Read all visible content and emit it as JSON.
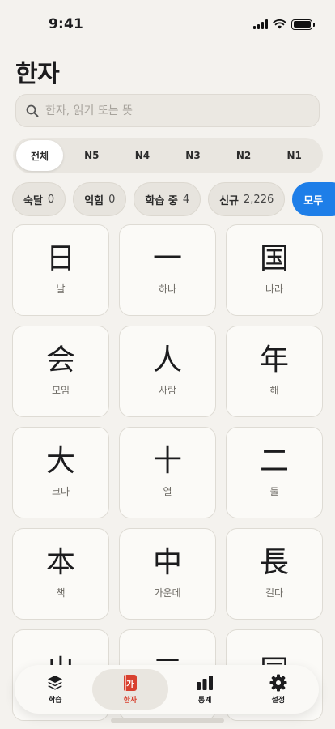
{
  "status": {
    "time": "9:41"
  },
  "page": {
    "title": "한자"
  },
  "search": {
    "placeholder": "한자, 읽기 또는 뜻",
    "value": ""
  },
  "levels": [
    "전체",
    "N5",
    "N4",
    "N3",
    "N2",
    "N1"
  ],
  "filters": [
    {
      "label": "숙달",
      "count": "0"
    },
    {
      "label": "익힘",
      "count": "0"
    },
    {
      "label": "학습 중",
      "count": "4"
    },
    {
      "label": "신규",
      "count": "2,226"
    },
    {
      "label": "모두",
      "count": ""
    }
  ],
  "cards": [
    {
      "kanji": "日",
      "meaning": "날"
    },
    {
      "kanji": "一",
      "meaning": "하나"
    },
    {
      "kanji": "国",
      "meaning": "나라"
    },
    {
      "kanji": "会",
      "meaning": "모임"
    },
    {
      "kanji": "人",
      "meaning": "사람"
    },
    {
      "kanji": "年",
      "meaning": "해"
    },
    {
      "kanji": "大",
      "meaning": "크다"
    },
    {
      "kanji": "十",
      "meaning": "열"
    },
    {
      "kanji": "二",
      "meaning": "둘"
    },
    {
      "kanji": "本",
      "meaning": "책"
    },
    {
      "kanji": "中",
      "meaning": "가운데"
    },
    {
      "kanji": "長",
      "meaning": "길다"
    },
    {
      "kanji": "出",
      "meaning": ""
    },
    {
      "kanji": "三",
      "meaning": ""
    },
    {
      "kanji": "同",
      "meaning": ""
    }
  ],
  "tabbar": {
    "items": [
      {
        "label": "학습",
        "icon": "layers-icon"
      },
      {
        "label": "한자",
        "icon": "book-icon",
        "glyph": "가"
      },
      {
        "label": "통계",
        "icon": "bar-chart-icon"
      },
      {
        "label": "설정",
        "icon": "gear-icon"
      }
    ]
  },
  "colors": {
    "accent": "#1e7ee8",
    "active_tab": "#d8412f",
    "background": "#f4f2ee"
  }
}
